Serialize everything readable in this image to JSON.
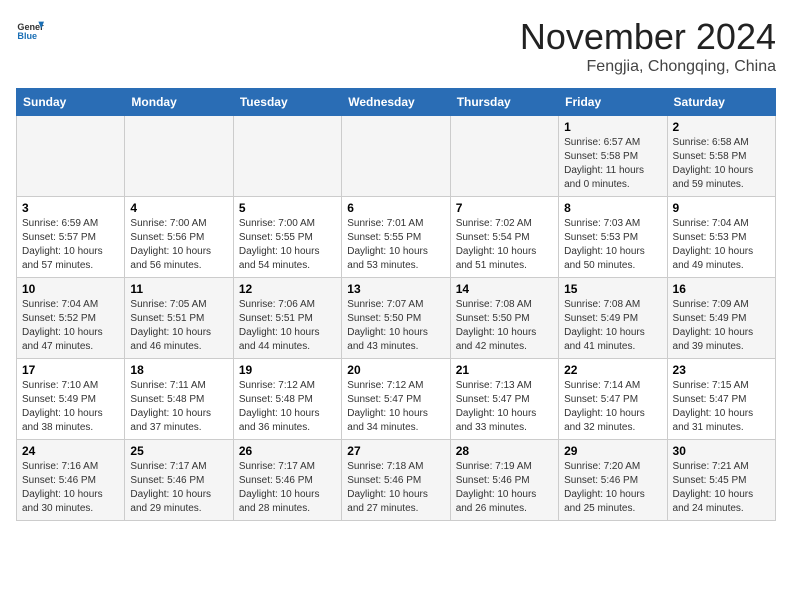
{
  "header": {
    "logo_line1": "General",
    "logo_line2": "Blue",
    "month_year": "November 2024",
    "location": "Fengjia, Chongqing, China"
  },
  "days_of_week": [
    "Sunday",
    "Monday",
    "Tuesday",
    "Wednesday",
    "Thursday",
    "Friday",
    "Saturday"
  ],
  "weeks": [
    [
      {
        "day": "",
        "info": ""
      },
      {
        "day": "",
        "info": ""
      },
      {
        "day": "",
        "info": ""
      },
      {
        "day": "",
        "info": ""
      },
      {
        "day": "",
        "info": ""
      },
      {
        "day": "1",
        "info": "Sunrise: 6:57 AM\nSunset: 5:58 PM\nDaylight: 11 hours and 0 minutes."
      },
      {
        "day": "2",
        "info": "Sunrise: 6:58 AM\nSunset: 5:58 PM\nDaylight: 10 hours and 59 minutes."
      }
    ],
    [
      {
        "day": "3",
        "info": "Sunrise: 6:59 AM\nSunset: 5:57 PM\nDaylight: 10 hours and 57 minutes."
      },
      {
        "day": "4",
        "info": "Sunrise: 7:00 AM\nSunset: 5:56 PM\nDaylight: 10 hours and 56 minutes."
      },
      {
        "day": "5",
        "info": "Sunrise: 7:00 AM\nSunset: 5:55 PM\nDaylight: 10 hours and 54 minutes."
      },
      {
        "day": "6",
        "info": "Sunrise: 7:01 AM\nSunset: 5:55 PM\nDaylight: 10 hours and 53 minutes."
      },
      {
        "day": "7",
        "info": "Sunrise: 7:02 AM\nSunset: 5:54 PM\nDaylight: 10 hours and 51 minutes."
      },
      {
        "day": "8",
        "info": "Sunrise: 7:03 AM\nSunset: 5:53 PM\nDaylight: 10 hours and 50 minutes."
      },
      {
        "day": "9",
        "info": "Sunrise: 7:04 AM\nSunset: 5:53 PM\nDaylight: 10 hours and 49 minutes."
      }
    ],
    [
      {
        "day": "10",
        "info": "Sunrise: 7:04 AM\nSunset: 5:52 PM\nDaylight: 10 hours and 47 minutes."
      },
      {
        "day": "11",
        "info": "Sunrise: 7:05 AM\nSunset: 5:51 PM\nDaylight: 10 hours and 46 minutes."
      },
      {
        "day": "12",
        "info": "Sunrise: 7:06 AM\nSunset: 5:51 PM\nDaylight: 10 hours and 44 minutes."
      },
      {
        "day": "13",
        "info": "Sunrise: 7:07 AM\nSunset: 5:50 PM\nDaylight: 10 hours and 43 minutes."
      },
      {
        "day": "14",
        "info": "Sunrise: 7:08 AM\nSunset: 5:50 PM\nDaylight: 10 hours and 42 minutes."
      },
      {
        "day": "15",
        "info": "Sunrise: 7:08 AM\nSunset: 5:49 PM\nDaylight: 10 hours and 41 minutes."
      },
      {
        "day": "16",
        "info": "Sunrise: 7:09 AM\nSunset: 5:49 PM\nDaylight: 10 hours and 39 minutes."
      }
    ],
    [
      {
        "day": "17",
        "info": "Sunrise: 7:10 AM\nSunset: 5:49 PM\nDaylight: 10 hours and 38 minutes."
      },
      {
        "day": "18",
        "info": "Sunrise: 7:11 AM\nSunset: 5:48 PM\nDaylight: 10 hours and 37 minutes."
      },
      {
        "day": "19",
        "info": "Sunrise: 7:12 AM\nSunset: 5:48 PM\nDaylight: 10 hours and 36 minutes."
      },
      {
        "day": "20",
        "info": "Sunrise: 7:12 AM\nSunset: 5:47 PM\nDaylight: 10 hours and 34 minutes."
      },
      {
        "day": "21",
        "info": "Sunrise: 7:13 AM\nSunset: 5:47 PM\nDaylight: 10 hours and 33 minutes."
      },
      {
        "day": "22",
        "info": "Sunrise: 7:14 AM\nSunset: 5:47 PM\nDaylight: 10 hours and 32 minutes."
      },
      {
        "day": "23",
        "info": "Sunrise: 7:15 AM\nSunset: 5:47 PM\nDaylight: 10 hours and 31 minutes."
      }
    ],
    [
      {
        "day": "24",
        "info": "Sunrise: 7:16 AM\nSunset: 5:46 PM\nDaylight: 10 hours and 30 minutes."
      },
      {
        "day": "25",
        "info": "Sunrise: 7:17 AM\nSunset: 5:46 PM\nDaylight: 10 hours and 29 minutes."
      },
      {
        "day": "26",
        "info": "Sunrise: 7:17 AM\nSunset: 5:46 PM\nDaylight: 10 hours and 28 minutes."
      },
      {
        "day": "27",
        "info": "Sunrise: 7:18 AM\nSunset: 5:46 PM\nDaylight: 10 hours and 27 minutes."
      },
      {
        "day": "28",
        "info": "Sunrise: 7:19 AM\nSunset: 5:46 PM\nDaylight: 10 hours and 26 minutes."
      },
      {
        "day": "29",
        "info": "Sunrise: 7:20 AM\nSunset: 5:46 PM\nDaylight: 10 hours and 25 minutes."
      },
      {
        "day": "30",
        "info": "Sunrise: 7:21 AM\nSunset: 5:45 PM\nDaylight: 10 hours and 24 minutes."
      }
    ]
  ]
}
